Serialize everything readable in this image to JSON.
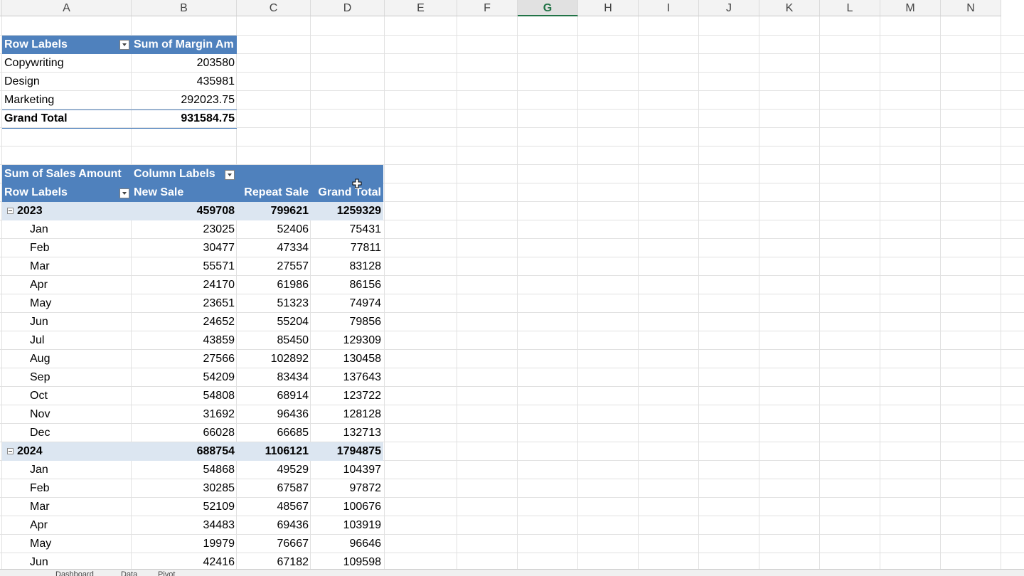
{
  "columns": [
    "A",
    "B",
    "C",
    "D",
    "E",
    "F",
    "G",
    "H",
    "I",
    "J",
    "K",
    "L",
    "M",
    "N"
  ],
  "selected_column": "G",
  "colors": {
    "header_fill": "#4f81bd",
    "band_fill": "#dce6f1",
    "selected_header": "#217346"
  },
  "pivot_margin": {
    "header_row_labels": "Row Labels",
    "header_value": "Sum of Margin Am",
    "rows": [
      {
        "label": "Copywriting",
        "value": "203580"
      },
      {
        "label": "Design",
        "value": "435981"
      },
      {
        "label": "Marketing",
        "value": "292023.75"
      }
    ],
    "grand_total_label": "Grand Total",
    "grand_total_value": "931584.75"
  },
  "pivot_sales": {
    "title": "Sum of Sales Amount",
    "column_labels": "Column Labels",
    "row_labels": "Row Labels",
    "col_new": "New Sale",
    "col_repeat": "Repeat Sale",
    "col_total": "Grand Total",
    "y2023": {
      "label": "2023",
      "new": "459708",
      "repeat": "799621",
      "total": "1259329"
    },
    "months2023": [
      {
        "m": "Jan",
        "new": "23025",
        "repeat": "52406",
        "total": "75431"
      },
      {
        "m": "Feb",
        "new": "30477",
        "repeat": "47334",
        "total": "77811"
      },
      {
        "m": "Mar",
        "new": "55571",
        "repeat": "27557",
        "total": "83128"
      },
      {
        "m": "Apr",
        "new": "24170",
        "repeat": "61986",
        "total": "86156"
      },
      {
        "m": "May",
        "new": "23651",
        "repeat": "51323",
        "total": "74974"
      },
      {
        "m": "Jun",
        "new": "24652",
        "repeat": "55204",
        "total": "79856"
      },
      {
        "m": "Jul",
        "new": "43859",
        "repeat": "85450",
        "total": "129309"
      },
      {
        "m": "Aug",
        "new": "27566",
        "repeat": "102892",
        "total": "130458"
      },
      {
        "m": "Sep",
        "new": "54209",
        "repeat": "83434",
        "total": "137643"
      },
      {
        "m": "Oct",
        "new": "54808",
        "repeat": "68914",
        "total": "123722"
      },
      {
        "m": "Nov",
        "new": "31692",
        "repeat": "96436",
        "total": "128128"
      },
      {
        "m": "Dec",
        "new": "66028",
        "repeat": "66685",
        "total": "132713"
      }
    ],
    "y2024": {
      "label": "2024",
      "new": "688754",
      "repeat": "1106121",
      "total": "1794875"
    },
    "months2024": [
      {
        "m": "Jan",
        "new": "54868",
        "repeat": "49529",
        "total": "104397"
      },
      {
        "m": "Feb",
        "new": "30285",
        "repeat": "67587",
        "total": "97872"
      },
      {
        "m": "Mar",
        "new": "52109",
        "repeat": "48567",
        "total": "100676"
      },
      {
        "m": "Apr",
        "new": "34483",
        "repeat": "69436",
        "total": "103919"
      },
      {
        "m": "May",
        "new": "19979",
        "repeat": "76667",
        "total": "96646"
      },
      {
        "m": "Jun",
        "new": "42416",
        "repeat": "67182",
        "total": "109598"
      }
    ]
  },
  "sheet_tabs": [
    "Dashboard",
    "Data",
    "Pivot"
  ]
}
